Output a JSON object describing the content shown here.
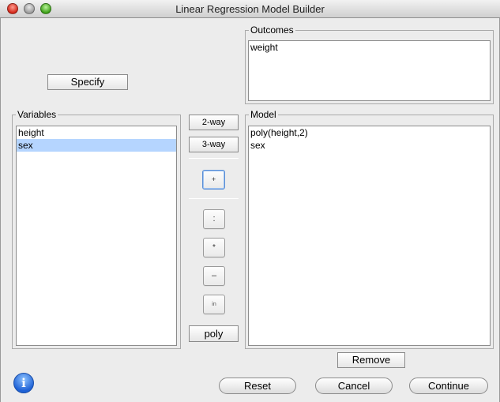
{
  "window": {
    "title": "Linear Regression Model Builder"
  },
  "outcomes": {
    "label": "Outcomes",
    "items": [
      "weight"
    ]
  },
  "specify_button": "Specify",
  "variables": {
    "label": "Variables",
    "items": [
      "height",
      "sex"
    ],
    "selected_index": 1
  },
  "operators": {
    "two_way": "2-way",
    "three_way": "3-way",
    "plus": "+",
    "colon": ":",
    "star": "*",
    "minus": "–",
    "in": "in",
    "poly": "poly"
  },
  "model": {
    "label": "Model",
    "items": [
      "poly(height,2)",
      "sex"
    ]
  },
  "remove_button": "Remove",
  "footer": {
    "reset": "Reset",
    "cancel": "Cancel",
    "continue": "Continue",
    "info": "i"
  }
}
